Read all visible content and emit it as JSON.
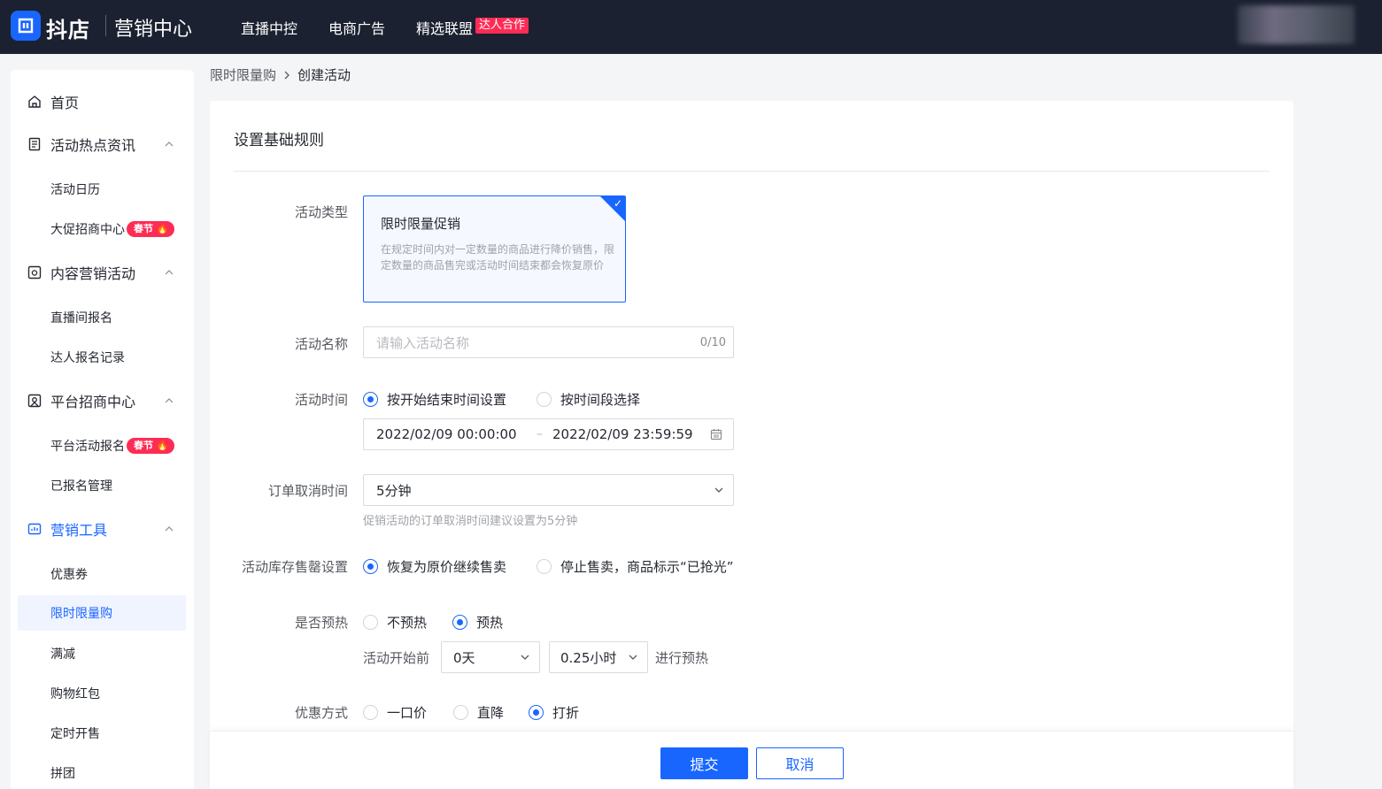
{
  "header": {
    "brand": "抖店",
    "sub_brand": "营销中心",
    "nav": [
      "直播中控",
      "电商广告",
      "精选联盟"
    ],
    "nav_badge": "达人合作"
  },
  "sidebar": {
    "home": "首页",
    "groups": [
      {
        "title": "活动热点资讯",
        "items": [
          "活动日历",
          "大促招商中心"
        ]
      },
      {
        "title": "内容营销活动",
        "items": [
          "直播间报名",
          "达人报名记录"
        ]
      },
      {
        "title": "平台招商中心",
        "items": [
          "平台活动报名",
          "已报名管理"
        ]
      },
      {
        "title": "营销工具",
        "items": [
          "优惠券",
          "限时限量购",
          "满减",
          "购物红包",
          "定时开售",
          "拼团"
        ]
      }
    ],
    "badge": "春节"
  },
  "breadcrumb": {
    "parent": "限时限量购",
    "current": "创建活动"
  },
  "form": {
    "section_title": "设置基础规则",
    "activity_type": {
      "label": "活动类型",
      "title": "限时限量促销",
      "desc": "在规定时间内对一定数量的商品进行降价销售，限定数量的商品售完或活动时间结束都会恢复原价"
    },
    "activity_name": {
      "label": "活动名称",
      "placeholder": "请输入活动名称",
      "counter": "0/10"
    },
    "activity_time": {
      "label": "活动时间",
      "options": [
        "按开始结束时间设置",
        "按时间段选择"
      ],
      "start": "2022/02/09 00:00:00",
      "separator": "–",
      "end": "2022/02/09 23:59:59"
    },
    "order_cancel": {
      "label": "订单取消时间",
      "value": "5分钟",
      "hint": "促销活动的订单取消时间建议设置为5分钟"
    },
    "stock_out": {
      "label": "活动库存售罄设置",
      "options": [
        "恢复为原价继续售卖",
        "停止售卖，商品标示“已抢光”"
      ]
    },
    "preheat": {
      "label": "是否预热",
      "options": [
        "不预热",
        "预热"
      ],
      "prefix": "活动开始前",
      "days": "0天",
      "hours": "0.25小时",
      "suffix": "进行预热"
    },
    "discount": {
      "label": "优惠方式",
      "options": [
        "一口价",
        "直降",
        "打折"
      ]
    }
  },
  "footer": {
    "submit": "提交",
    "cancel": "取消"
  },
  "colors": {
    "primary": "#1966ff",
    "topbar": "#1b2130",
    "badge": "#fe2c55"
  }
}
